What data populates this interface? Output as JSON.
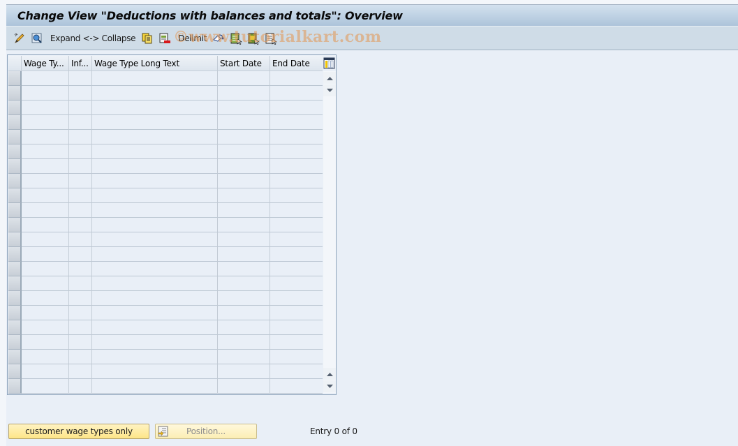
{
  "window": {
    "title": "Change View \"Deductions with balances and totals\": Overview"
  },
  "toolbar": {
    "items": [
      {
        "type": "icon",
        "name": "display-change-icon"
      },
      {
        "type": "icon",
        "name": "find-icon"
      },
      {
        "type": "text",
        "label": "Expand <-> Collapse"
      },
      {
        "type": "icon",
        "name": "copy-as-icon"
      },
      {
        "type": "icon",
        "name": "delete-icon"
      },
      {
        "type": "text",
        "label": "Delimit"
      },
      {
        "type": "icon",
        "name": "undo-change-icon"
      },
      {
        "type": "icon",
        "name": "select-all-icon"
      },
      {
        "type": "icon",
        "name": "select-block-icon"
      },
      {
        "type": "icon",
        "name": "deselect-all-icon"
      }
    ],
    "expand_collapse_label": "Expand <-> Collapse",
    "delimit_label": "Delimit"
  },
  "watermark": "©www.tutorialkart.com",
  "table": {
    "columns": [
      {
        "label": "Wage Ty..."
      },
      {
        "label": "Inf..."
      },
      {
        "label": "Wage Type Long Text"
      },
      {
        "label": "Start Date"
      },
      {
        "label": "End Date"
      }
    ],
    "rows": [],
    "visible_empty_rows": 22,
    "column_settings_icon": "table-settings-icon"
  },
  "footer": {
    "customer_button_label": "customer wage types only",
    "position_button_label": "Position...",
    "entry_text": "Entry 0 of 0"
  }
}
